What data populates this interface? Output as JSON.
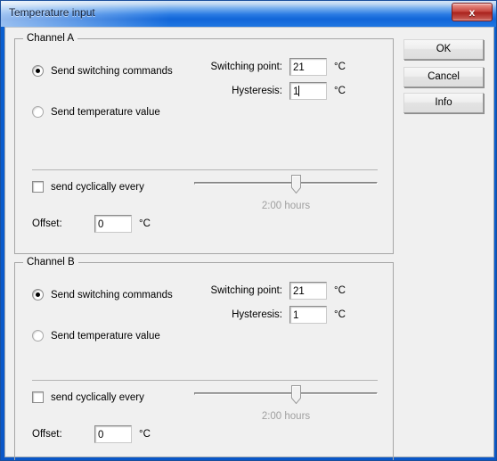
{
  "window": {
    "title": "Temperature input",
    "close_label": "x",
    "close_icon": "close-icon"
  },
  "buttons": {
    "ok": "OK",
    "cancel": "Cancel",
    "info": "Info"
  },
  "labels": {
    "switching_point": "Switching point:",
    "hysteresis": "Hysteresis:",
    "offset": "Offset:",
    "send_switching": "Send switching commands",
    "send_temperature": "Send temperature value",
    "send_cyclically": "send cyclically every",
    "unit_celsius": "°C"
  },
  "channel_a": {
    "title": "Channel A",
    "mode_switching_label": "Send switching commands",
    "mode_temperature_label": "Send temperature value",
    "mode_switching_selected": true,
    "mode_temperature_selected": false,
    "switching_point_label": "Switching point:",
    "switching_point_value": "21",
    "switching_point_unit": "°C",
    "hysteresis_label": "Hysteresis:",
    "hysteresis_value": "1",
    "hysteresis_unit": "°C",
    "hysteresis_has_caret": true,
    "cyclic_label": "send cyclically every",
    "cyclic_checked": false,
    "cyclic_interval": "2:00 hours",
    "offset_label": "Offset:",
    "offset_value": "0",
    "offset_unit": "°C"
  },
  "channel_b": {
    "title": "Channel B",
    "mode_switching_label": "Send switching commands",
    "mode_temperature_label": "Send temperature value",
    "mode_switching_selected": true,
    "mode_temperature_selected": false,
    "switching_point_label": "Switching point:",
    "switching_point_value": "21",
    "switching_point_unit": "°C",
    "hysteresis_label": "Hysteresis:",
    "hysteresis_value": "1",
    "hysteresis_unit": "°C",
    "hysteresis_has_caret": false,
    "cyclic_label": "send cyclically every",
    "cyclic_checked": false,
    "cyclic_interval": "2:00 hours",
    "offset_label": "Offset:",
    "offset_value": "0",
    "offset_unit": "°C"
  },
  "colors": {
    "titlebar_blue": "#1266d8",
    "window_border": "#0a57c8",
    "dialog_face": "#f0f0f0",
    "close_red": "#c4433c",
    "disabled_text": "#a0a0a0"
  }
}
